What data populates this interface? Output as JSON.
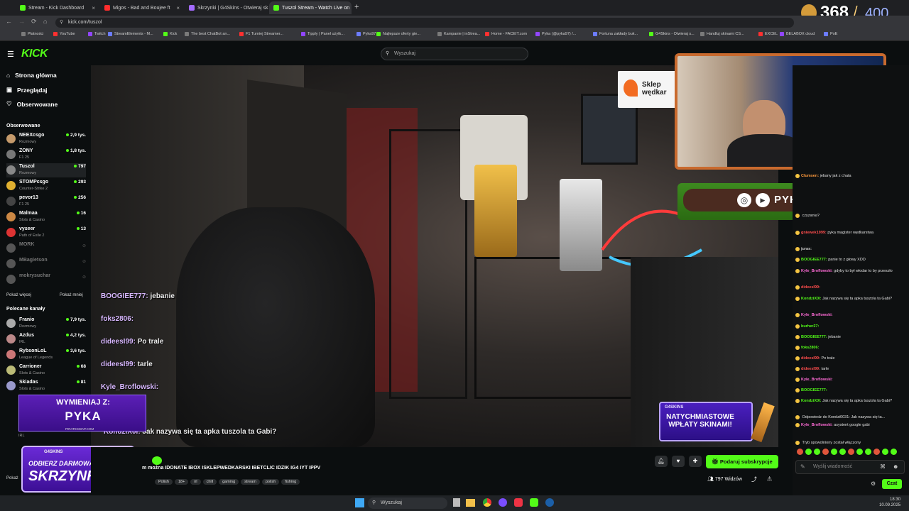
{
  "browser": {
    "tabs": [
      {
        "title": "Stream - Kick Dashboard",
        "color": "#53fc18"
      },
      {
        "title": "Migos - Bad and Boujee ft",
        "color": "#ff2d2d"
      },
      {
        "title": "Skrzynki | G4Skins - Otwieraj sk",
        "color": "#a36bff"
      },
      {
        "title": "Tuszol Stream - Watch Live on",
        "color": "#53fc18"
      }
    ],
    "url": "kick.com/tuszol",
    "bookmarks": [
      "Płatności",
      "YouTube",
      "Twitch",
      "StreamElements - M...",
      "Kick",
      "The best ChatBot an...",
      "F1 Turniej Streamer...",
      "Tipply | Panel użytk...",
      "Pyka97",
      "Najlepsze oferty gie...",
      "Kampanie | inStrea...",
      "Home - FACEIT.com",
      "Pyka (@pyka97) /...",
      "Fortuna zakłady buk...",
      "G4Skins - Otwieraj s...",
      "Handluj skinami CS...",
      "EXCEL",
      "BELABOX cloud",
      "PoE"
    ]
  },
  "overlay_counter": {
    "current": "368",
    "slash": "/",
    "max": "400"
  },
  "kick": {
    "logo": "KICK",
    "search_placeholder": "Wyszukaj",
    "nav": [
      "Strona główna",
      "Przeglądaj",
      "Obserwowane"
    ],
    "followed_heading": "Obserwowane",
    "followed": [
      {
        "name": "NEEXcsgo",
        "cat": "Rozmowy",
        "viewers": "2,9 tys.",
        "color": "#c59a6b"
      },
      {
        "name": "ZONY",
        "cat": "F1 25",
        "viewers": "1,8 tys.",
        "color": "#777"
      },
      {
        "name": "Tuszol",
        "cat": "Rozmowy",
        "viewers": "797",
        "color": "#888"
      },
      {
        "name": "STOMPcsgo",
        "cat": "Counter-Strike 2",
        "viewers": "293",
        "color": "#e0b030"
      },
      {
        "name": "pevor13",
        "cat": "F1 25",
        "viewers": "256",
        "color": "#444"
      },
      {
        "name": "Malmaa",
        "cat": "Slots & Casino",
        "viewers": "16",
        "color": "#c84"
      },
      {
        "name": "vyseer",
        "cat": "Path of Exile 2",
        "viewers": "13",
        "color": "#d33"
      },
      {
        "name": "MORK",
        "cat": "",
        "viewers": "",
        "color": "#555"
      },
      {
        "name": "MBagietson",
        "cat": "",
        "viewers": "",
        "color": "#555"
      },
      {
        "name": "mokrysuchar",
        "cat": "",
        "viewers": "",
        "color": "#555"
      }
    ],
    "show_more": "Pokaż więcej",
    "show_less": "Pokaż mniej",
    "recommended_heading": "Polecane kanały",
    "recommended": [
      {
        "name": "Franio",
        "cat": "Rozmowy",
        "viewers": "7,9 tys.",
        "color": "#aaa"
      },
      {
        "name": "Azdus",
        "cat": "IRL",
        "viewers": "4,2 tys.",
        "color": "#b88"
      },
      {
        "name": "RybsonLoL",
        "cat": "League of Legends",
        "viewers": "3,6 tys.",
        "color": "#c77"
      },
      {
        "name": "Carrioner",
        "cat": "Slots & Casino",
        "viewers": "68",
        "color": "#bb7"
      },
      {
        "name": "Skiadas",
        "cat": "Slots & Casino",
        "viewers": "81",
        "color": "#99c"
      }
    ],
    "sidebar_bottom": [
      "IRL",
      "Pokaż"
    ]
  },
  "video_overlay": {
    "sklep": "Sklep wędkar",
    "chat_lines": [
      {
        "user": "BOOGIEE777:",
        "msg": "jebanie"
      },
      {
        "user": "foks2806:",
        "msg": ""
      },
      {
        "user": "dideesI99:",
        "msg": "Po trale"
      },
      {
        "user": "dideesI99:",
        "msg": "tarle"
      },
      {
        "user": "Kyle_Broflowski:",
        "msg": ""
      },
      {
        "user": "E777:",
        "msg": ""
      },
      {
        "user": "KondziX0I:",
        "msg": "Jak nazywa się ta apka tuszola ta Gabi?"
      }
    ],
    "pyka_social": "PYKA97",
    "wymieniaj": "WYMIENIAJ Z:",
    "pyka": "PYKA",
    "pirateswap": "PIRATESWAP.COM",
    "g4_brand": "G4SKINS",
    "natychmiastowe": "NATYCHMIASTOWE WPŁATY SKINAMI!",
    "odbierz": "ODBIERZ DARMOWĄ",
    "skrzynke": "SKRZYNKĘ!"
  },
  "stream_info": {
    "title_line": "m można  IDONATE IBOX ISKLEPWEDKARSKI IBETCLIC IDZIK IG4 IYT IPPV",
    "tags": [
      "Polish",
      "18+",
      "irl",
      "chill",
      "gaming",
      "stream",
      "polish",
      "fishing"
    ],
    "subscribe": "Podaruj subskrypcje",
    "viewers": "797 Widzów"
  },
  "chat": {
    "messages": [
      {
        "user": "Clumsen:",
        "msg": "jebany jak z chata",
        "ucolor": "#ff9a3c"
      },
      {
        "user": "",
        "msg": "czyzania?",
        "ucolor": "#ccc"
      },
      {
        "user": "gniewek1999:",
        "msg": "pyka magister wędkarstwa",
        "ucolor": "#ff4d4d"
      },
      {
        "user": "juras:",
        "msg": "",
        "ucolor": "#ccc"
      },
      {
        "user": "BOOGIEE777:",
        "msg": "panie to z głowy XDD",
        "ucolor": "#53fc18"
      },
      {
        "user": "Kyle_Broflowski:",
        "msg": "gdyby to był włodar to by przeszło",
        "ucolor": "#ff6bd6"
      },
      {
        "user": "dideesI99:",
        "msg": "",
        "ucolor": "#ff4d4d"
      },
      {
        "user": "KondziX0I:",
        "msg": "Jak nazywa się ta apka tuszola ta Gabi?",
        "ucolor": "#53fc18"
      },
      {
        "user": "Kyle_Broflowski:",
        "msg": "",
        "ucolor": "#ff6bd6"
      },
      {
        "user": "burher27:",
        "msg": "",
        "ucolor": "#53fc18"
      },
      {
        "user": "BOOGIEE777:",
        "msg": "jebanie",
        "ucolor": "#53fc18"
      },
      {
        "user": "foks2806:",
        "msg": "",
        "ucolor": "#53fc18"
      },
      {
        "user": "dideesI99:",
        "msg": "Po trale",
        "ucolor": "#ff4d4d"
      },
      {
        "user": "dideesI99:",
        "msg": "tarle",
        "ucolor": "#ff4d4d"
      },
      {
        "user": "Kyle_Broflowski:",
        "msg": "",
        "ucolor": "#ff6bd6"
      },
      {
        "user": "BOOGIEE777:",
        "msg": "",
        "ucolor": "#53fc18"
      },
      {
        "user": "KondziX0I:",
        "msg": "Jak nazywa się ta apka tuszola ta Gabi?",
        "ucolor": "#53fc18"
      },
      {
        "user": "",
        "msg": "Odpowiedz do Kondzi0031: Jak nazywa się ta...",
        "ucolor": "#888"
      },
      {
        "user": "Kyle_Broflowski:",
        "msg": "asystent google gabi",
        "ucolor": "#ff6bd6"
      },
      {
        "user": "",
        "msg": "Tryb spowolniony został włączony",
        "ucolor": "#888"
      }
    ],
    "input_placeholder": "Wyślij wiadomość",
    "send": "Czat"
  },
  "taskbar": {
    "search": "Wyszukaj",
    "time": "18:30",
    "date": "10.09.2025"
  }
}
